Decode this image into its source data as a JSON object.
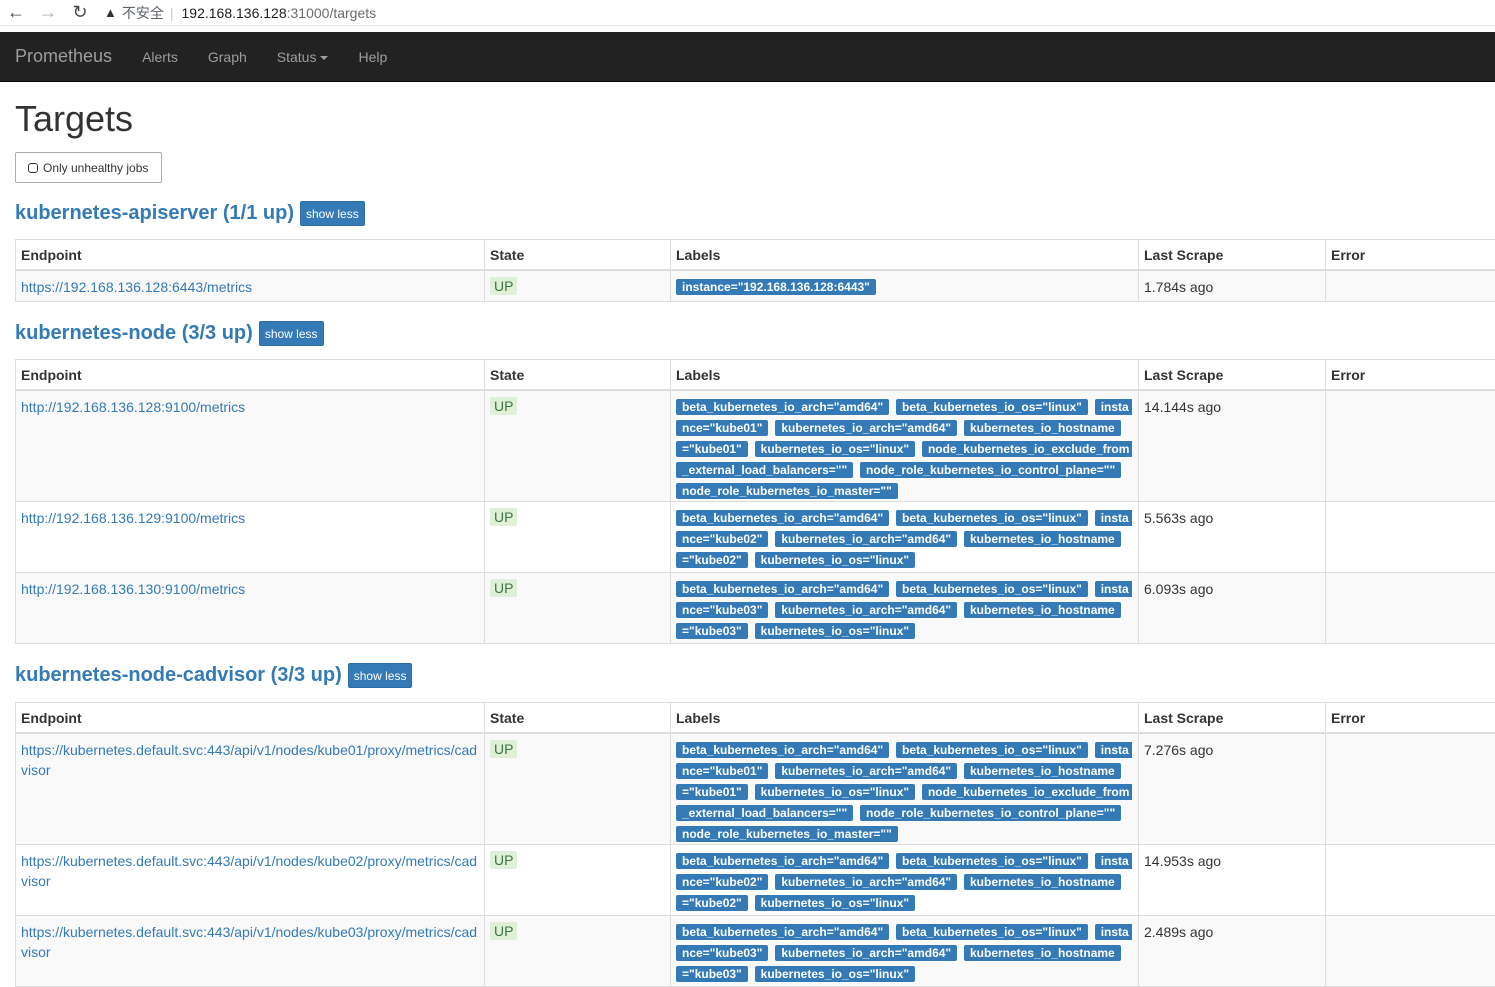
{
  "browser": {
    "insecure_label": "不安全",
    "url_host": "192.168.136.128",
    "url_path": ":31000/targets"
  },
  "nav": {
    "brand": "Prometheus",
    "items": [
      "Alerts",
      "Graph",
      "Status",
      "Help"
    ]
  },
  "page": {
    "title": "Targets",
    "filter_label": "Only unhealthy jobs"
  },
  "table_headers": [
    "Endpoint",
    "State",
    "Labels",
    "Last Scrape",
    "Error"
  ],
  "jobs": [
    {
      "title": "kubernetes-apiserver (1/1 up)",
      "toggle": "show less",
      "rows": [
        {
          "endpoint": "https://192.168.136.128:6443/metrics",
          "state": "UP",
          "labels": [
            "instance=\"192.168.136.128:6443\""
          ],
          "last_scrape": "1.784s ago",
          "error": ""
        }
      ]
    },
    {
      "title": "kubernetes-node (3/3 up)",
      "toggle": "show less",
      "rows": [
        {
          "endpoint": "http://192.168.136.128:9100/metrics",
          "state": "UP",
          "labels": [
            "beta_kubernetes_io_arch=\"amd64\"",
            "beta_kubernetes_io_os=\"linux\"",
            "instance=\"kube01\"",
            "kubernetes_io_arch=\"amd64\"",
            "kubernetes_io_hostname=\"kube01\"",
            "kubernetes_io_os=\"linux\"",
            "node_kubernetes_io_exclude_from_external_load_balancers=\"\"",
            "node_role_kubernetes_io_control_plane=\"\"",
            "node_role_kubernetes_io_master=\"\""
          ],
          "last_scrape": "14.144s ago",
          "error": ""
        },
        {
          "endpoint": "http://192.168.136.129:9100/metrics",
          "state": "UP",
          "labels": [
            "beta_kubernetes_io_arch=\"amd64\"",
            "beta_kubernetes_io_os=\"linux\"",
            "instance=\"kube02\"",
            "kubernetes_io_arch=\"amd64\"",
            "kubernetes_io_hostname=\"kube02\"",
            "kubernetes_io_os=\"linux\""
          ],
          "last_scrape": "5.563s ago",
          "error": ""
        },
        {
          "endpoint": "http://192.168.136.130:9100/metrics",
          "state": "UP",
          "labels": [
            "beta_kubernetes_io_arch=\"amd64\"",
            "beta_kubernetes_io_os=\"linux\"",
            "instance=\"kube03\"",
            "kubernetes_io_arch=\"amd64\"",
            "kubernetes_io_hostname=\"kube03\"",
            "kubernetes_io_os=\"linux\""
          ],
          "last_scrape": "6.093s ago",
          "error": ""
        }
      ]
    },
    {
      "title": "kubernetes-node-cadvisor (3/3 up)",
      "toggle": "show less",
      "rows": [
        {
          "endpoint": "https://kubernetes.default.svc:443/api/v1/nodes/kube01/proxy/metrics/cadvisor",
          "state": "UP",
          "labels": [
            "beta_kubernetes_io_arch=\"amd64\"",
            "beta_kubernetes_io_os=\"linux\"",
            "instance=\"kube01\"",
            "kubernetes_io_arch=\"amd64\"",
            "kubernetes_io_hostname=\"kube01\"",
            "kubernetes_io_os=\"linux\"",
            "node_kubernetes_io_exclude_from_external_load_balancers=\"\"",
            "node_role_kubernetes_io_control_plane=\"\"",
            "node_role_kubernetes_io_master=\"\""
          ],
          "last_scrape": "7.276s ago",
          "error": ""
        },
        {
          "endpoint": "https://kubernetes.default.svc:443/api/v1/nodes/kube02/proxy/metrics/cadvisor",
          "state": "UP",
          "labels": [
            "beta_kubernetes_io_arch=\"amd64\"",
            "beta_kubernetes_io_os=\"linux\"",
            "instance=\"kube02\"",
            "kubernetes_io_arch=\"amd64\"",
            "kubernetes_io_hostname=\"kube02\"",
            "kubernetes_io_os=\"linux\""
          ],
          "last_scrape": "14.953s ago",
          "error": ""
        },
        {
          "endpoint": "https://kubernetes.default.svc:443/api/v1/nodes/kube03/proxy/metrics/cadvisor",
          "state": "UP",
          "labels": [
            "beta_kubernetes_io_arch=\"amd64\"",
            "beta_kubernetes_io_os=\"linux\"",
            "instance=\"kube03\"",
            "kubernetes_io_arch=\"amd64\"",
            "kubernetes_io_hostname=\"kube03\"",
            "kubernetes_io_os=\"linux\""
          ],
          "last_scrape": "2.489s ago",
          "error": ""
        }
      ]
    }
  ]
}
